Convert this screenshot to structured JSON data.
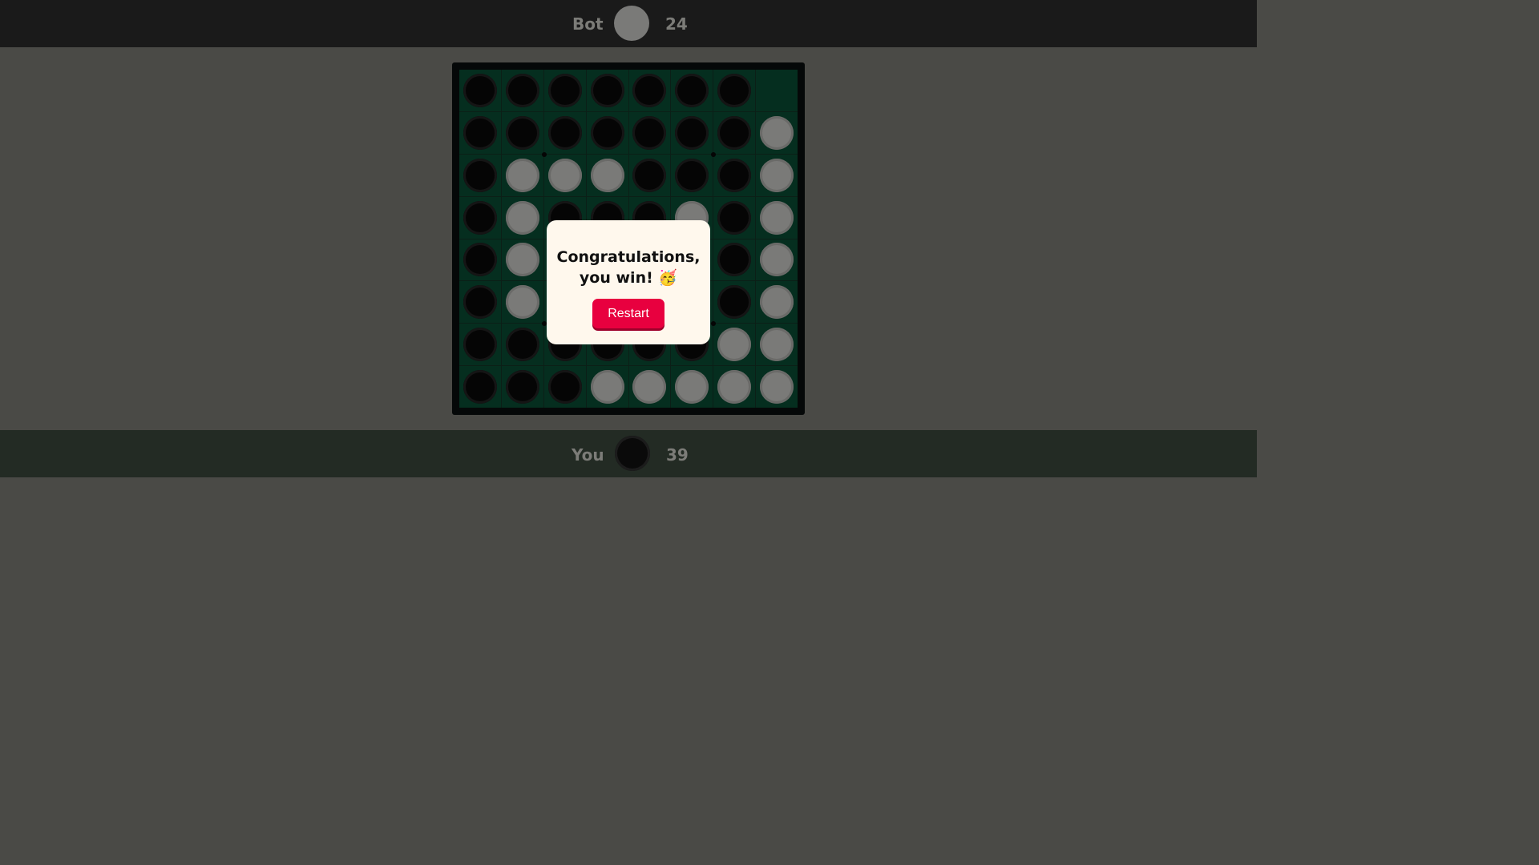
{
  "top_player": {
    "name": "Bot",
    "score": "24",
    "disc_color": "white"
  },
  "bottom_player": {
    "name": "You",
    "score": "39",
    "disc_color": "black"
  },
  "board": {
    "rows": [
      [
        "B",
        "B",
        "B",
        "B",
        "B",
        "B",
        "B",
        "."
      ],
      [
        "B",
        "B",
        "B",
        "B",
        "B",
        "B",
        "B",
        "W"
      ],
      [
        "B",
        "W",
        "W",
        "W",
        "B",
        "B",
        "B",
        "W"
      ],
      [
        "B",
        "W",
        "B",
        "B",
        "B",
        "W",
        "B",
        "W"
      ],
      [
        "B",
        "W",
        "B",
        "B",
        "B",
        "B",
        "B",
        "W"
      ],
      [
        "B",
        "W",
        "B",
        "B",
        "B",
        "B",
        "B",
        "W"
      ],
      [
        "B",
        "B",
        "B",
        "B",
        "B",
        "B",
        "W",
        "W"
      ],
      [
        "B",
        "B",
        "B",
        "W",
        "W",
        "W",
        "W",
        "W"
      ]
    ]
  },
  "modal": {
    "message_line1": "Congratulations,",
    "message_line2": "you win!",
    "emoji": "🥳",
    "restart_label": "Restart"
  },
  "colors": {
    "board_cell": "#052e1f",
    "restart_button": "#e8003f",
    "modal_bg": "#fff8ed"
  }
}
